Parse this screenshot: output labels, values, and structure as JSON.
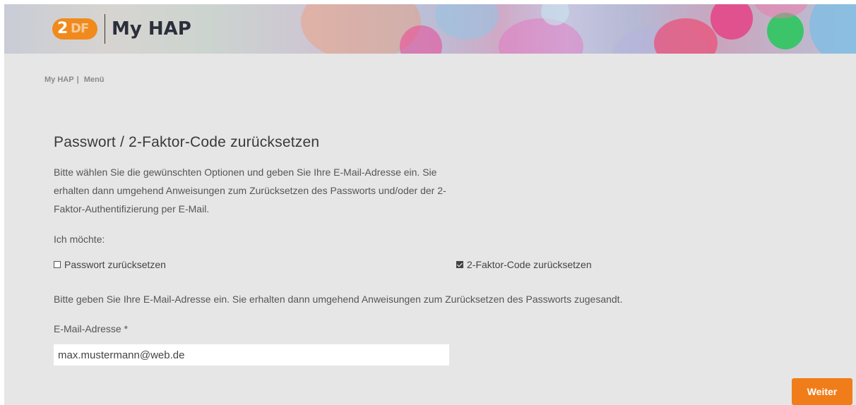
{
  "header": {
    "logo_alt": "ZDF",
    "logo_z": "2",
    "logo_df": "DF",
    "app_title": "My HAP"
  },
  "breadcrumb": {
    "home": "My HAP",
    "separator": "|",
    "menu": "Menü"
  },
  "form": {
    "title": "Passwort / 2-Faktor-Code zurücksetzen",
    "intro": "Bitte wählen Sie die gewünschten Optionen und geben Sie Ihre E-Mail-Adresse ein. Sie erhalten dann umgehend Anweisungen zum Zurücksetzen des Passworts und/oder der 2-Faktor-Authentifizierung per E-Mail.",
    "want_label": "Ich möchte:",
    "option_password": {
      "label": "Passwort zurücksetzen",
      "checked": false
    },
    "option_2fa": {
      "label": "2-Faktor-Code zurücksetzen",
      "checked": true
    },
    "note": "Bitte geben Sie Ihre E-Mail-Adresse ein. Sie erhalten dann umgehend Anweisungen zum Zurücksetzen des Passworts zugesandt.",
    "email_label": "E-Mail-Adresse *",
    "email_value": "max.mustermann@web.de",
    "submit_label": "Weiter"
  },
  "colors": {
    "accent": "#f07d1a",
    "background": "#e6e6e6",
    "zdf_orange": "#f08a1c"
  }
}
